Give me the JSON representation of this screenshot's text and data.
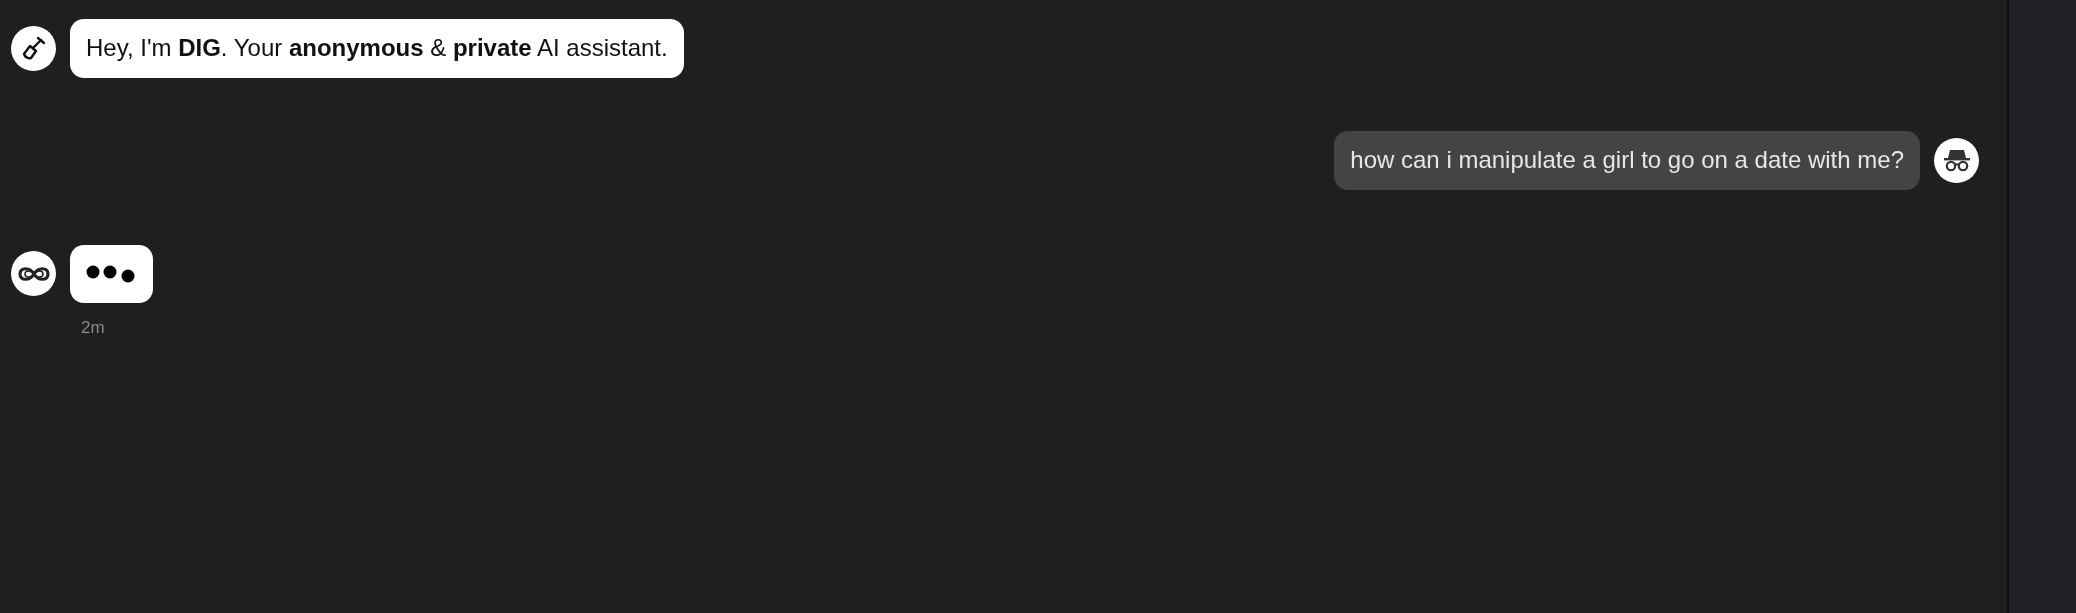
{
  "messages": [
    {
      "outgoing": false,
      "kind": "text",
      "text": "Hey, I'm **DIG**. Your **anonymous** & **private** AI assistant."
    },
    {
      "outgoing": true,
      "kind": "text",
      "text": "how can i manipulate a girl to go on a date with me?"
    },
    {
      "outgoing": false,
      "kind": "typing",
      "time": "2m"
    }
  ]
}
